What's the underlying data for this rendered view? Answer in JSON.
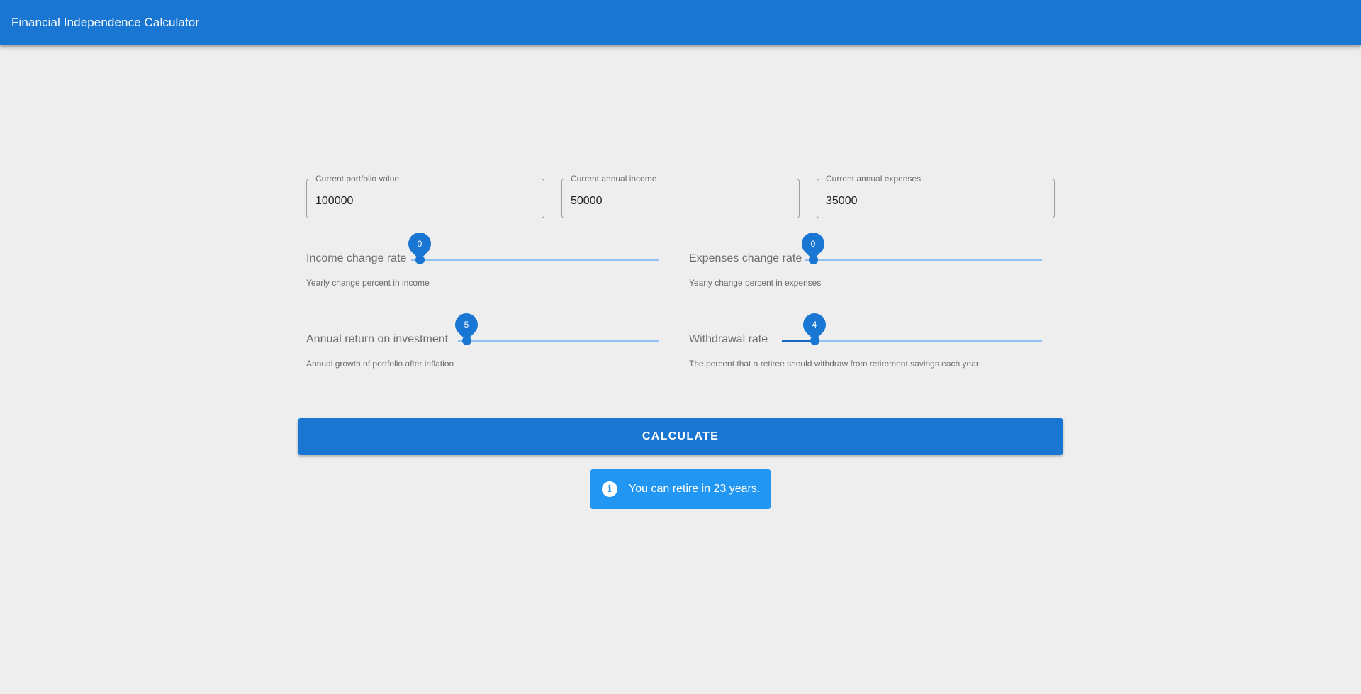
{
  "app": {
    "title": "Financial Independence Calculator"
  },
  "fields": {
    "portfolio": {
      "label": "Current portfolio value",
      "value": "100000"
    },
    "income": {
      "label": "Current annual income",
      "value": "50000"
    },
    "expenses": {
      "label": "Current annual expenses",
      "value": "35000"
    }
  },
  "sliders": {
    "income_change": {
      "label": "Income change rate",
      "value": "0",
      "help": "Yearly change percent in income"
    },
    "expenses_change": {
      "label": "Expenses change rate",
      "value": "0",
      "help": "Yearly change percent in expenses"
    },
    "annual_return": {
      "label": "Annual return on investment",
      "value": "5",
      "help": "Annual growth of portfolio after inflation"
    },
    "withdrawal": {
      "label": "Withdrawal rate",
      "value": "4",
      "help": "The percent that a retiree should withdraw from retirement savings each year"
    }
  },
  "actions": {
    "calculate_label": "CALCULATE"
  },
  "result": {
    "icon": "info-icon",
    "message": "You can retire in 23 years."
  },
  "colors": {
    "primary": "#1976d2",
    "info": "#2196f3",
    "background": "#eeeeee"
  }
}
